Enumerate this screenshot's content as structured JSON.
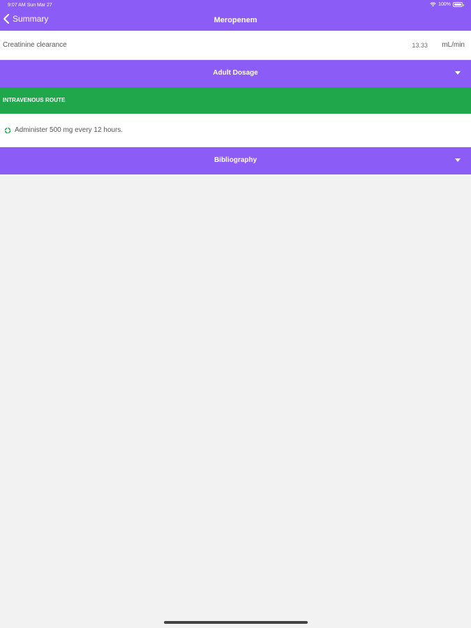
{
  "status_bar": {
    "time_date": "9:07 AM   Sun Mar 27",
    "battery_text": "100%"
  },
  "nav": {
    "back_label": "Summary",
    "title": "Meropenem"
  },
  "creatinine": {
    "label": "Creatinine clearance",
    "value": "13.33",
    "unit": "mL/min"
  },
  "adult_dosage": {
    "title": "Adult Dosage"
  },
  "route": {
    "label": "INTRAVENOUS ROUTE",
    "instruction": "Administer 500 mg every 12 hours."
  },
  "bibliography": {
    "title": "Bibliography"
  },
  "colors": {
    "header_purple": "#8b5cf6",
    "route_green": "#20a64b",
    "background": "#f2f2f2"
  },
  "icons": {
    "back": "chevron-left-icon",
    "expand": "caret-down-icon",
    "bullet": "recycle-icon",
    "wifi": "wifi-icon",
    "battery": "battery-icon"
  }
}
